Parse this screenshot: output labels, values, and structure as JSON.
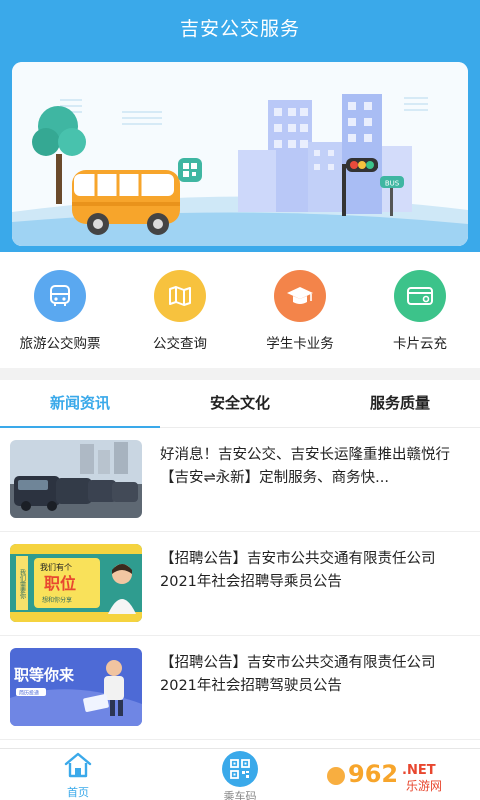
{
  "app": {
    "title": "吉安公交服务"
  },
  "quick_menu": [
    {
      "label": "旅游公交购票",
      "icon": "bus-icon",
      "color": "#5aa8f0"
    },
    {
      "label": "公交查询",
      "icon": "map-icon",
      "color": "#f7c23e"
    },
    {
      "label": "学生卡业务",
      "icon": "graduation-cap-icon",
      "color": "#f3844a"
    },
    {
      "label": "卡片云充",
      "icon": "card-icon",
      "color": "#3cc38a"
    }
  ],
  "tabs": [
    {
      "label": "新闻资讯",
      "active": true
    },
    {
      "label": "安全文化",
      "active": false
    },
    {
      "label": "服务质量",
      "active": false
    }
  ],
  "news": [
    {
      "title": "好消息！吉安公交、吉安长运隆重推出赣悦行【吉安⇌永新】定制服务、商务快..."
    },
    {
      "title": "【招聘公告】吉安市公共交通有限责任公司2021年社会招聘导乘员公告",
      "thumb_text": [
        "我们有个",
        "职位",
        "想和你分享",
        "我们需要你"
      ]
    },
    {
      "title": "【招聘公告】吉安市公共交通有限责任公司2021年社会招聘驾驶员公告",
      "thumb_text": [
        "职等你来",
        "简历投递"
      ]
    }
  ],
  "bottom_nav": [
    {
      "label": "首页",
      "icon": "home-icon",
      "active": true
    },
    {
      "label": "乘车码",
      "icon": "qr-code-icon",
      "active": false
    }
  ],
  "banner": {
    "bus_stop_sign": "BUS"
  },
  "watermark": {
    "number": "962",
    "net": ".NET",
    "cn": "乐游网"
  },
  "colors": {
    "primary": "#3aa9ea",
    "bus_body": "#f7a52b",
    "accent": "#3aa9ea"
  }
}
